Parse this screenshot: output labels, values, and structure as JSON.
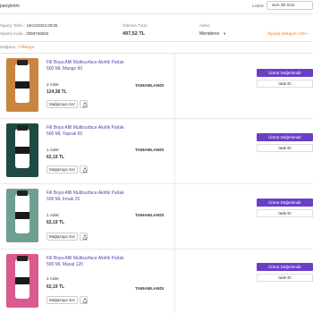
{
  "header": {
    "breadcrumb": "parişlerim",
    "list_label": "Listele",
    "list_value": "Son 30 Gün"
  },
  "summary": {
    "order_date_label": "Sipariş Tarihi",
    "order_date_value": "19/12/2024 00:05",
    "order_code_label": "Sipariş Kodu",
    "order_code_value": "2059736832",
    "total_label": "Ödenen Tutar",
    "total_value": "497,52 TL",
    "address_label": "Adres",
    "address_value": "Menderes",
    "detail_link": "Sipariş Detayını Gör"
  },
  "store": {
    "label": "Mağaza :",
    "name": "FillBoya"
  },
  "items": [
    {
      "name": "Fill Boya Afill Multisurface Akrilik Parlak 500 ML Mango 90",
      "qty": "2 Adet",
      "price": "124,38 TL",
      "ask_label": "Mağazaya Sor",
      "status": "TAMAMLANDI",
      "evaluate_label": "Ürünü Değerlendir",
      "return_label": "İade Et",
      "thumb_color": "#c9843f"
    },
    {
      "name": "Fill Boya Afill Multisurface Akrilik Parlak 500 ML Yaprak 65",
      "qty": "1 Adet",
      "price": "62,19 TL",
      "ask_label": "Mağazaya Sor",
      "status": "TAMAMLANDI",
      "evaluate_label": "Ürünü Değerlendir",
      "return_label": "İade Et",
      "thumb_color": "#1f4a43"
    },
    {
      "name": "Fill Boya Afill Multisurface Akrilik Parlak 500 ML Irmak 25",
      "qty": "1 Adet",
      "price": "62,19 TL",
      "ask_label": "Mağazaya Sor",
      "status": "TAMAMLANDI",
      "evaluate_label": "Ürünü Değerlendir",
      "return_label": "İade Et",
      "thumb_color": "#6f9e93"
    },
    {
      "name": "Fill Boya Afill Multisurface Akrilik Parlak 500 ML Masal 120",
      "qty": "1 Adet",
      "price": "62,19 TL",
      "ask_label": "Mağazaya Sor",
      "status": "TAMAMLANDI",
      "evaluate_label": "Ürünü Değerlendir",
      "return_label": "İade Et",
      "thumb_color": "#d95a8e"
    }
  ],
  "colors": {
    "accent": "#f27a1a",
    "primary_button": "#6a3fc7",
    "product_link": "#5b3fa8"
  }
}
